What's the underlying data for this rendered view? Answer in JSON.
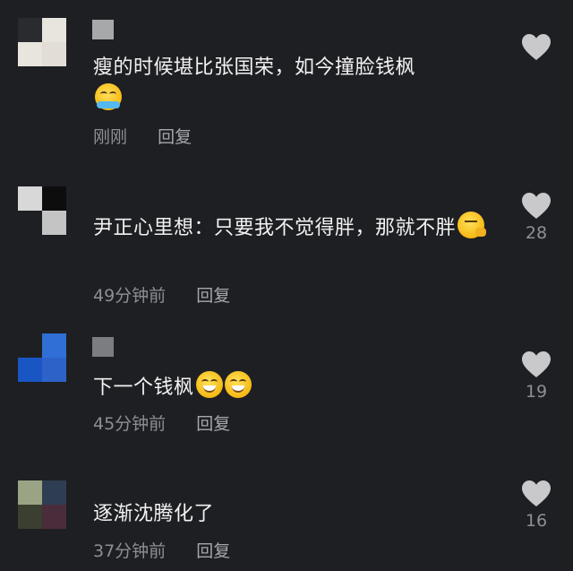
{
  "comments": [
    {
      "text": "瘦的时候堪比张国荣，如今撞脸钱枫",
      "emoji": [
        "cry-laugh-icon"
      ],
      "time": "刚刚",
      "reply": "回复",
      "likes": "",
      "avatar_colors": [
        "#2a2b2f",
        "#e8e4de",
        "#3a3b3f",
        "#e2ddd6"
      ],
      "name_color": "#a7a8aa"
    },
    {
      "text": "尹正心里想：只要我不觉得胖，那就不胖",
      "emoji": [
        "thinking-face-icon"
      ],
      "time": "49分钟前",
      "reply": "回复",
      "likes": "28",
      "avatar_colors": [
        "#d8d8d8",
        "#0d0d0d",
        "#1e1f23",
        "#c4c4c4"
      ],
      "name_color": "#2a2b2f"
    },
    {
      "text": "下一个钱枫",
      "emoji": [
        "grinning-squint-icon",
        "grinning-squint-icon"
      ],
      "time": "45分钟前",
      "reply": "回复",
      "likes": "19",
      "avatar_colors": [
        "#1e1f23",
        "#2f6fd6",
        "#1a55c4",
        "#2d63c8"
      ],
      "name_color": "#7c7d80"
    },
    {
      "text": "逐渐沈腾化了",
      "emoji": [],
      "time": "37分钟前",
      "reply": "回复",
      "likes": "16",
      "avatar_colors": [
        "#9aa383",
        "#2f3d52",
        "#3b3f2f",
        "#4a2d3a"
      ],
      "name_color": "#1e1f23"
    }
  ],
  "colors": {
    "background": "#1e1f23",
    "text": "#f2f2f2",
    "meta": "#8e8f93",
    "heart": "#c9c9cc"
  }
}
